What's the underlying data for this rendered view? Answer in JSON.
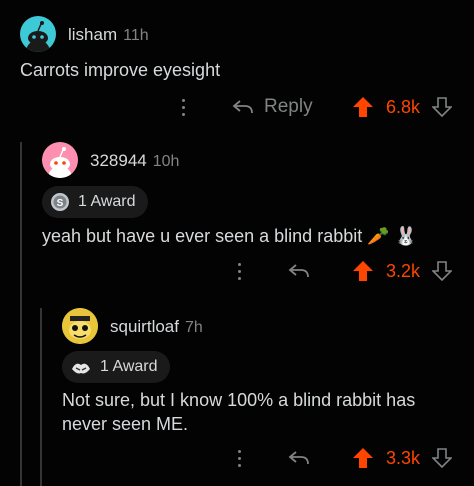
{
  "colors": {
    "upvote": "#ff4500",
    "background": "#030303",
    "muted": "#818384",
    "text": "#d7dadc"
  },
  "comments": [
    {
      "username": "lisham",
      "time": "11h",
      "avatar_icon": "snoo-avatar-teal",
      "body": "Carrots improve eyesight",
      "reply_label": "Reply",
      "score": "6.8k"
    },
    {
      "username": "328944",
      "time": "10h",
      "avatar_icon": "snoo-avatar-pink",
      "award": {
        "icon": "silver-award-icon",
        "label": "1 Award"
      },
      "body": "yeah but have u ever seen a blind rabbit",
      "emoji": "🥕 🐰",
      "score": "3.2k"
    },
    {
      "username": "squirtloaf",
      "time": "7h",
      "avatar_icon": "custom-avatar-yellow",
      "award": {
        "icon": "wholesome-award-icon",
        "label": "1 Award"
      },
      "body_line1": "Not sure, but I know 100% a blind rabbit has",
      "body_line2": "never seen ME.",
      "score": "3.3k"
    }
  ]
}
